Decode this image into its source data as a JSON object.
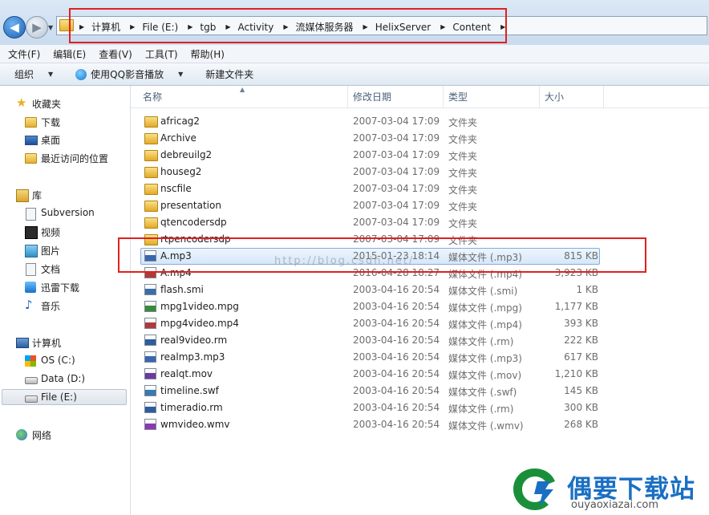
{
  "address": {
    "crumbs": [
      "计算机",
      "File (E:)",
      "tgb",
      "Activity",
      "流媒体服务器",
      "HelixServer",
      "Content"
    ]
  },
  "menu": [
    "文件(F)",
    "编辑(E)",
    "查看(V)",
    "工具(T)",
    "帮助(H)"
  ],
  "toolbar": {
    "organize": "组织",
    "qq_play": "使用QQ影音播放",
    "new_folder": "新建文件夹"
  },
  "sidebar": {
    "favorites": "收藏夹",
    "downloads": "下载",
    "desktop": "桌面",
    "recent": "最近访问的位置",
    "libraries": "库",
    "subversion": "Subversion",
    "videos": "视频",
    "pictures": "图片",
    "documents": "文档",
    "xunlei": "迅雷下载",
    "music": "音乐",
    "computer": "计算机",
    "os_c": "OS (C:)",
    "data_d": "Data (D:)",
    "file_e": "File (E:)",
    "network": "网络"
  },
  "columns": {
    "name": "名称",
    "date": "修改日期",
    "type": "类型",
    "size": "大小"
  },
  "files": [
    {
      "name": "africag2",
      "date": "2007-03-04 17:09",
      "type": "文件夹",
      "size": "",
      "icon": "folder"
    },
    {
      "name": "Archive",
      "date": "2007-03-04 17:09",
      "type": "文件夹",
      "size": "",
      "icon": "folder"
    },
    {
      "name": "debreuilg2",
      "date": "2007-03-04 17:09",
      "type": "文件夹",
      "size": "",
      "icon": "folder"
    },
    {
      "name": "houseg2",
      "date": "2007-03-04 17:09",
      "type": "文件夹",
      "size": "",
      "icon": "folder"
    },
    {
      "name": "nscfile",
      "date": "2007-03-04 17:09",
      "type": "文件夹",
      "size": "",
      "icon": "folder"
    },
    {
      "name": "presentation",
      "date": "2007-03-04 17:09",
      "type": "文件夹",
      "size": "",
      "icon": "folder"
    },
    {
      "name": "qtencodersdp",
      "date": "2007-03-04 17:09",
      "type": "文件夹",
      "size": "",
      "icon": "folder"
    },
    {
      "name": "rtpencodersdp",
      "date": "2007-03-04 17:09",
      "type": "文件夹",
      "size": "",
      "icon": "folder"
    },
    {
      "name": "A.mp3",
      "date": "2015-01-23 18:14",
      "type": "媒体文件 (.mp3)",
      "size": "815 KB",
      "icon": "MP3"
    },
    {
      "name": "A.mp4",
      "date": "2016-04-28 18:27",
      "type": "媒体文件 (.mp4)",
      "size": "3,923 KB",
      "icon": "MP4"
    },
    {
      "name": "flash.smi",
      "date": "2003-04-16 20:54",
      "type": "媒体文件 (.smi)",
      "size": "1 KB",
      "icon": "SMI"
    },
    {
      "name": "mpg1video.mpg",
      "date": "2003-04-16 20:54",
      "type": "媒体文件 (.mpg)",
      "size": "1,177 KB",
      "icon": "MPG"
    },
    {
      "name": "mpg4video.mp4",
      "date": "2003-04-16 20:54",
      "type": "媒体文件 (.mp4)",
      "size": "393 KB",
      "icon": "MP4"
    },
    {
      "name": "real9video.rm",
      "date": "2003-04-16 20:54",
      "type": "媒体文件 (.rm)",
      "size": "222 KB",
      "icon": "RM"
    },
    {
      "name": "realmp3.mp3",
      "date": "2003-04-16 20:54",
      "type": "媒体文件 (.mp3)",
      "size": "617 KB",
      "icon": "MP3"
    },
    {
      "name": "realqt.mov",
      "date": "2003-04-16 20:54",
      "type": "媒体文件 (.mov)",
      "size": "1,210 KB",
      "icon": "MOV"
    },
    {
      "name": "timeline.swf",
      "date": "2003-04-16 20:54",
      "type": "媒体文件 (.swf)",
      "size": "145 KB",
      "icon": "SWF"
    },
    {
      "name": "timeradio.rm",
      "date": "2003-04-16 20:54",
      "type": "媒体文件 (.rm)",
      "size": "300 KB",
      "icon": "RM"
    },
    {
      "name": "wmvideo.wmv",
      "date": "2003-04-16 20:54",
      "type": "媒体文件 (.wmv)",
      "size": "268 KB",
      "icon": "WMV"
    }
  ],
  "selected_file": "A.mp3",
  "icon_colors": {
    "MP3": "#3a66b0",
    "MP4": "#b03a3a",
    "SMI": "#3a6fa5",
    "MPG": "#3a8a3a",
    "RM": "#2d5d9c",
    "MOV": "#6b3aa0",
    "SWF": "#3a7ab0",
    "WMV": "#8a3ab0"
  },
  "watermark": {
    "url": "http://blog.csdn.net/",
    "brand": "偶要下载站",
    "domain": "ouyaoxiazai.com"
  }
}
